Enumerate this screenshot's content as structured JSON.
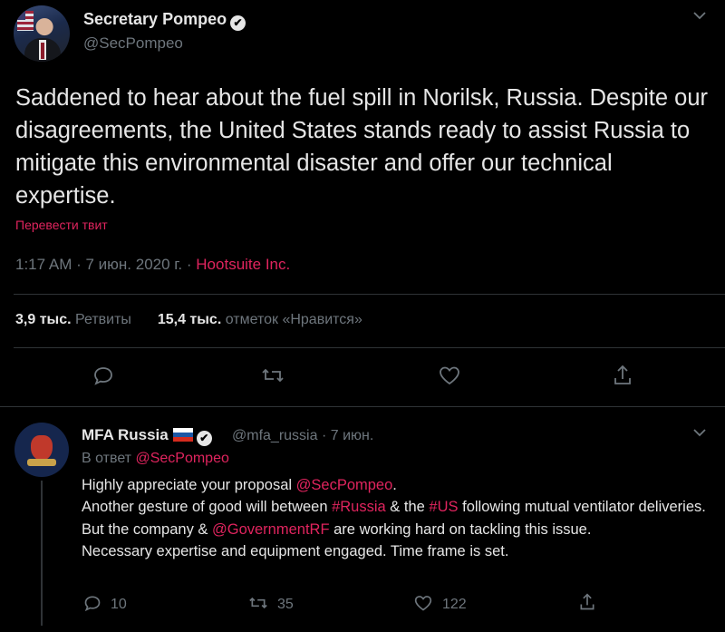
{
  "main_tweet": {
    "author_name": "Secretary Pompeo",
    "author_handle": "@SecPompeo",
    "verified_icon": "✔",
    "menu_icon": "chevron-down-icon",
    "text": "Saddened to hear about the fuel spill in Norilsk, Russia. Despite our disagreements, the United States stands ready to assist Russia to mitigate this environmental disaster and offer our technical expertise.",
    "translate_label": "Перевести твит",
    "time": "1:17 AM",
    "date": "7 июн. 2020 г.",
    "source": "Hootsuite Inc.",
    "retweets_count": "3,9 тыс.",
    "retweets_label": "Ретвиты",
    "likes_count": "15,4 тыс.",
    "likes_label": "отметок «Нравится»"
  },
  "reply_tweet": {
    "author_name": "MFA Russia",
    "author_handle": "@mfa_russia",
    "date": "7 июн.",
    "reply_prefix": "В ответ",
    "reply_to": "@SecPompeo",
    "line1_text": "Highly appreciate your proposal ",
    "line1_mention": "@SecPompeo",
    "line1_end": ".",
    "line2_a": "Another gesture of good will between ",
    "line2_tag1": "#Russia",
    "line2_b": " & the ",
    "line2_tag2": "#US",
    "line2_c": " following mutual ventilator deliveries.",
    "line3_a": "But the company & ",
    "line3_mention": "@GovernmentRF",
    "line3_b": " are working hard on tackling this issue.",
    "line4": "Necessary expertise and equipment engaged. Time frame is set.",
    "replies": "10",
    "retweets": "35",
    "likes": "122"
  },
  "colors": {
    "background": "#000000",
    "accent": "#e0245e",
    "muted": "#6e767d",
    "divider": "#2f3336"
  }
}
